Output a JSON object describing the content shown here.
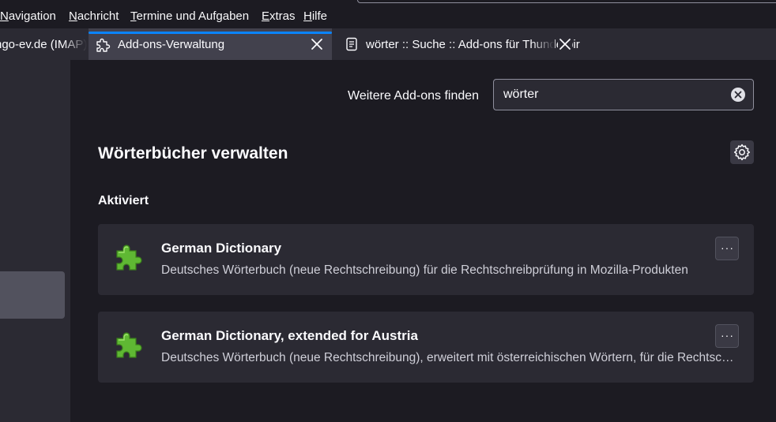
{
  "menubar": {
    "items": [
      "Navigation",
      "Nachricht",
      "Termine und Aufgaben",
      "Extras",
      "Hilfe"
    ]
  },
  "tabs": [
    {
      "label": "ngo-ev.de (IMAP)"
    },
    {
      "label": "Add-ons-Verwaltung",
      "active": true
    },
    {
      "label": "wörter :: Suche :: Add-ons für Thunderbird"
    }
  ],
  "main": {
    "find_label": "Weitere Add-ons finden",
    "search_value": "wörter",
    "heading": "Wörterbücher verwalten",
    "section_label": "Aktiviert",
    "addons": [
      {
        "name": "German Dictionary",
        "description": "Deutsches Wörterbuch (neue Rechtschreibung) für die Rechtschreibprüfung in Mozilla-Produkten",
        "more_label": "···"
      },
      {
        "name": "German Dictionary, extended for Austria",
        "description": "Deutsches Wörterbuch (neue Rechtschreibung), erweitert mit österreichischen Wörtern, für die Rechtschreibprüfung in Mozilla-Produkten",
        "more_label": "···"
      }
    ]
  },
  "colors": {
    "accent": "#0a84ff",
    "puzzle_green": "#5fb833"
  },
  "icons": {
    "tab_addons": "puzzle-icon",
    "tab_page": "document-icon",
    "close": "close-icon",
    "clear": "clear-icon",
    "settings": "gear-icon"
  }
}
